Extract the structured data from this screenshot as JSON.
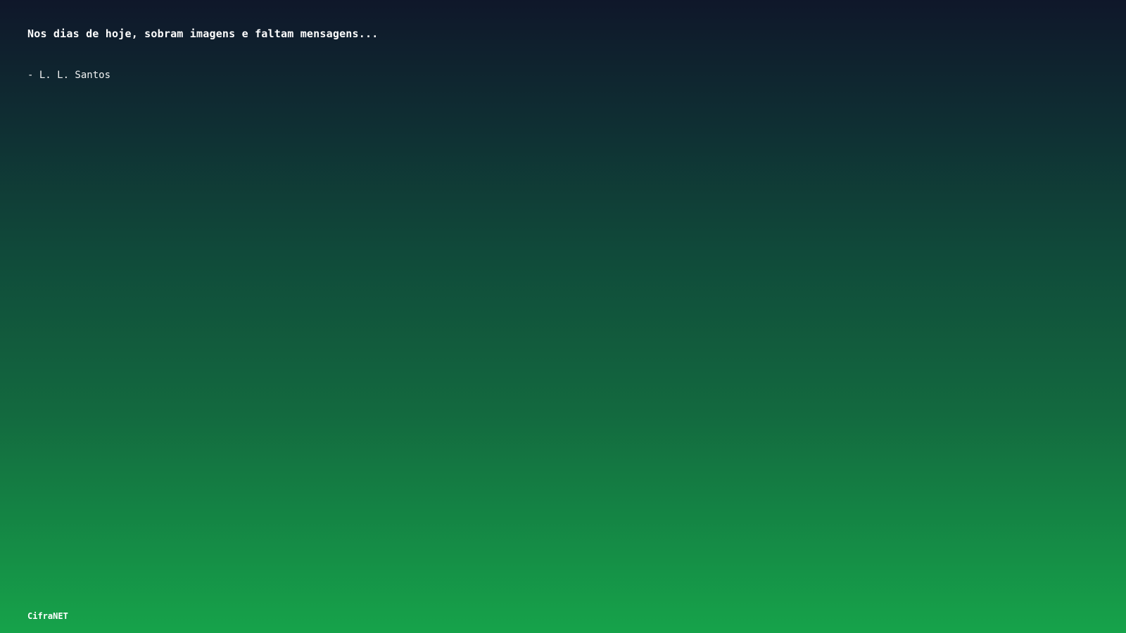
{
  "quote": {
    "text": "Nos dias de hoje, sobram imagens e faltam mensagens...",
    "author": "- L. L. Santos"
  },
  "brand": {
    "name": "CifraNET"
  }
}
